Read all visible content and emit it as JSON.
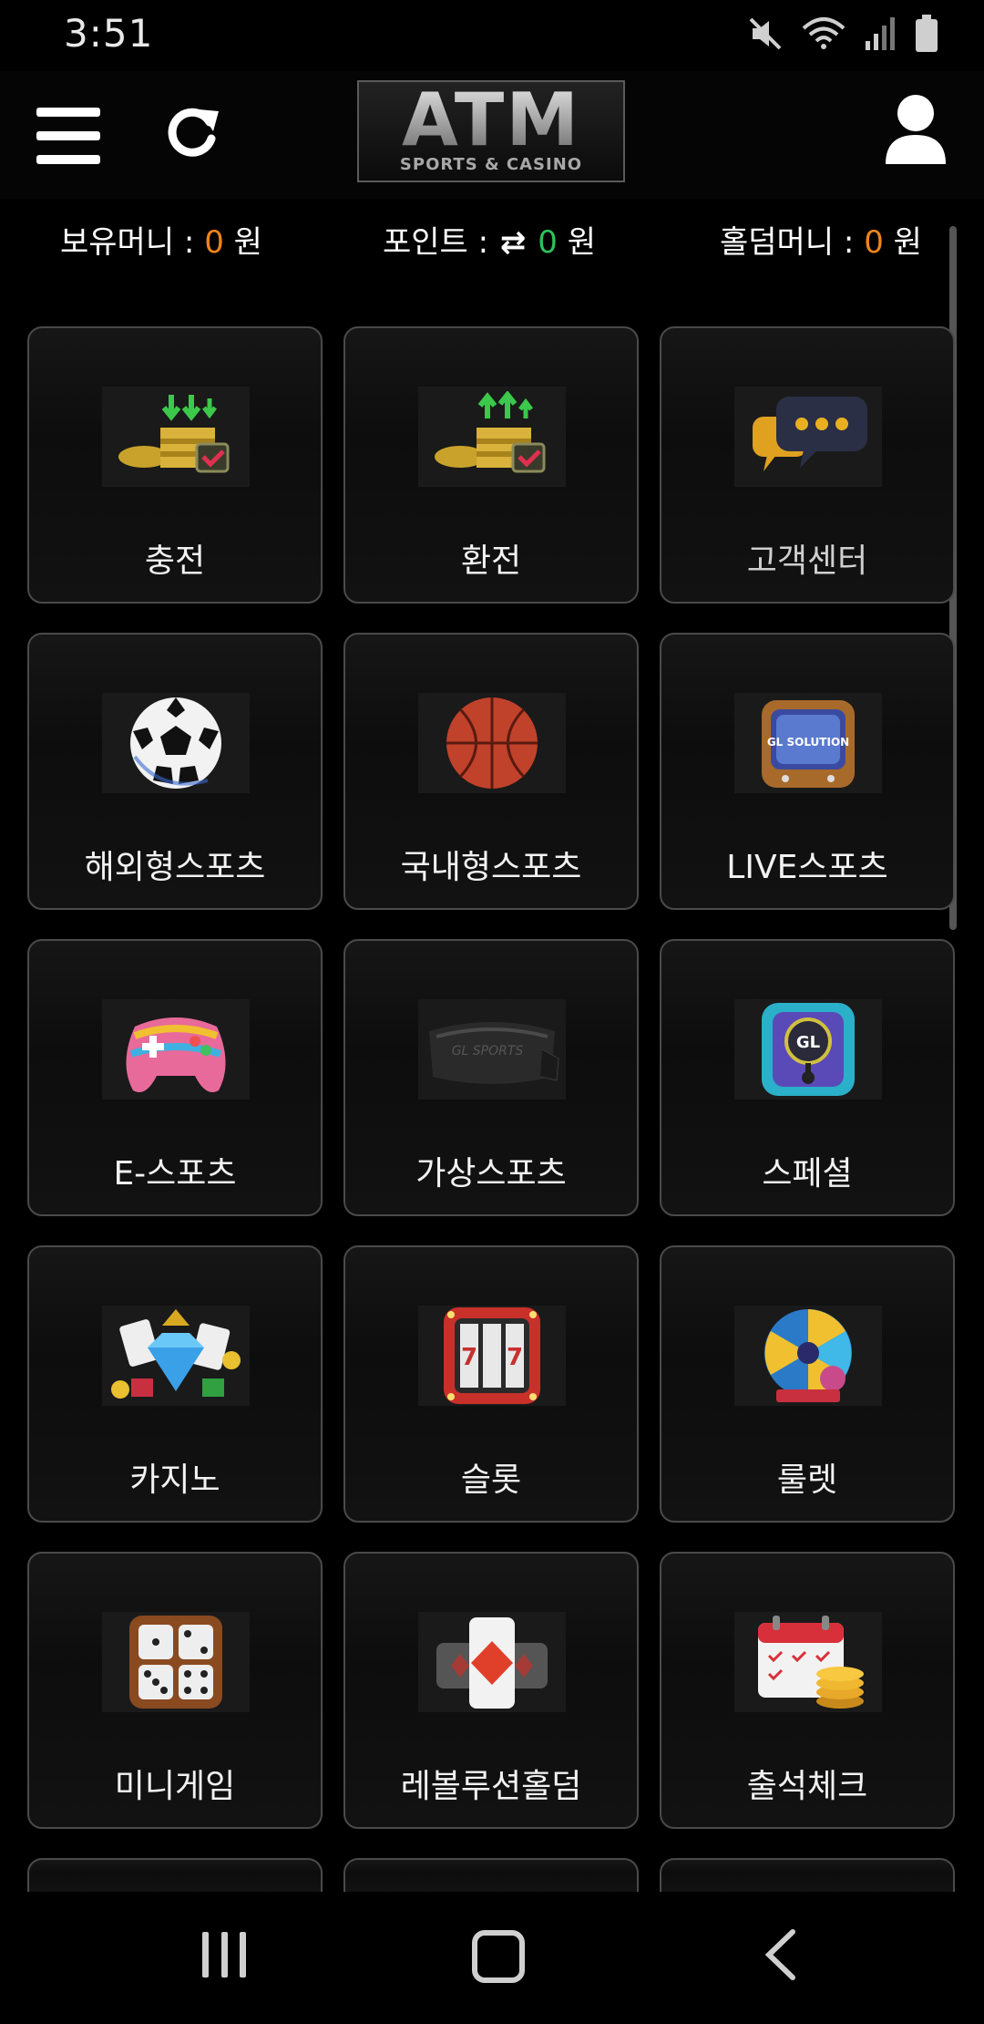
{
  "status_bar": {
    "time": "3:51"
  },
  "header": {
    "logo_text": "ATM",
    "logo_subtitle": "SPORTS & CASINO"
  },
  "balances": {
    "money_label": "보유머니 :",
    "money_value": "0",
    "money_unit": "원",
    "point_label": "포인트 :",
    "point_value": "0",
    "point_unit": "원",
    "holdem_label": "홀덤머니 :",
    "holdem_value": "0",
    "holdem_unit": "원"
  },
  "tiles": [
    {
      "label": "충전",
      "icon": "coins-deposit-icon"
    },
    {
      "label": "환전",
      "icon": "coins-withdraw-icon"
    },
    {
      "label": "고객센터",
      "icon": "chat-bubble-icon"
    },
    {
      "label": "해외형스포츠",
      "icon": "soccer-ball-icon"
    },
    {
      "label": "국내형스포츠",
      "icon": "basketball-icon"
    },
    {
      "label": "LIVE스포츠",
      "icon": "retro-tv-icon"
    },
    {
      "label": "E-스포츠",
      "icon": "gamepad-icon"
    },
    {
      "label": "가상스포츠",
      "icon": "vr-headset-icon"
    },
    {
      "label": "스페셜",
      "icon": "arcade-icon"
    },
    {
      "label": "카지노",
      "icon": "casino-gems-icon"
    },
    {
      "label": "슬롯",
      "icon": "slot-machine-icon"
    },
    {
      "label": "룰렛",
      "icon": "roulette-wheel-icon"
    },
    {
      "label": "미니게임",
      "icon": "dice-icon"
    },
    {
      "label": "레볼루션홀덤",
      "icon": "playing-card-icon"
    },
    {
      "label": "출석체크",
      "icon": "calendar-coins-icon"
    }
  ],
  "colors": {
    "accent_orange": "#f0841a",
    "accent_green": "#2cc35a",
    "tile_border": "#4a4a4a",
    "background": "#000000"
  }
}
